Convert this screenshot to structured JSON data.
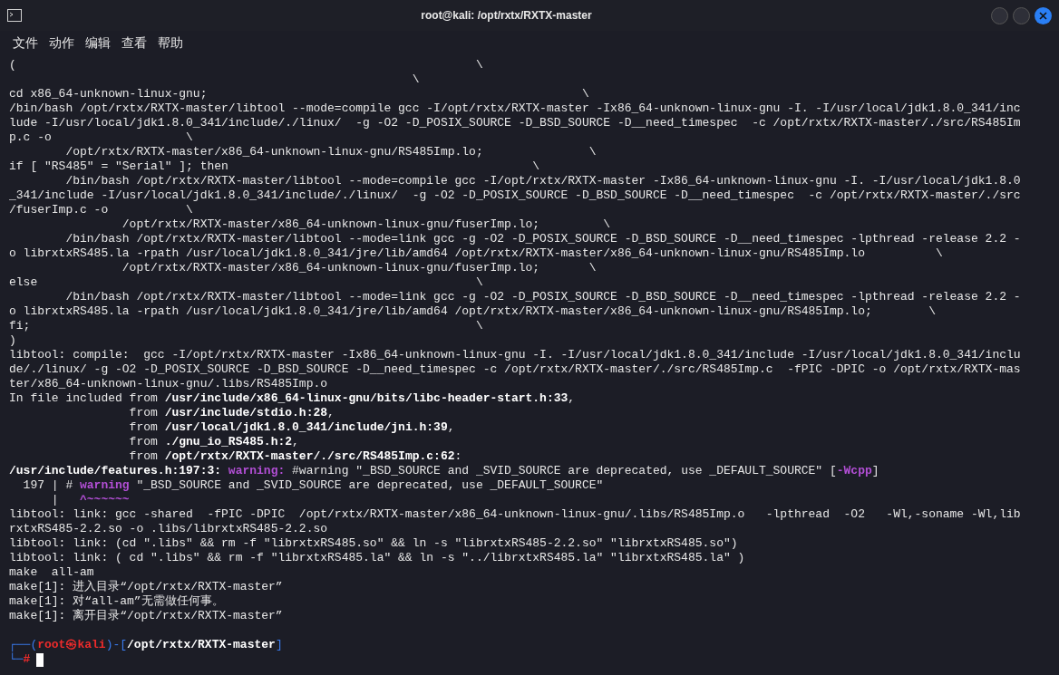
{
  "window": {
    "title": "root@kali: /opt/rxtx/RXTX-master"
  },
  "menu": [
    "文件",
    "动作",
    "编辑",
    "查看",
    "帮助"
  ],
  "lines": [
    {
      "segments": [
        {
          "kind": "plain",
          "text": "(                                                                 \\"
        }
      ]
    },
    {
      "segments": [
        {
          "kind": "plain",
          "text": "                                                         \\"
        }
      ]
    },
    {
      "segments": [
        {
          "kind": "plain",
          "text": "cd x86_64-unknown-linux-gnu;                                                     \\"
        }
      ]
    },
    {
      "segments": [
        {
          "kind": "plain",
          "text": "/bin/bash /opt/rxtx/RXTX-master/libtool --mode=compile gcc -I/opt/rxtx/RXTX-master -Ix86_64-unknown-linux-gnu -I. -I/usr/local/jdk1.8.0_341/inc"
        }
      ]
    },
    {
      "segments": [
        {
          "kind": "plain",
          "text": "lude -I/usr/local/jdk1.8.0_341/include/./linux/  -g -O2 -D_POSIX_SOURCE -D_BSD_SOURCE -D__need_timespec  -c /opt/rxtx/RXTX-master/./src/RS485Im"
        }
      ]
    },
    {
      "segments": [
        {
          "kind": "plain",
          "text": "p.c -o                   \\"
        }
      ]
    },
    {
      "segments": [
        {
          "kind": "plain",
          "text": "        /opt/rxtx/RXTX-master/x86_64-unknown-linux-gnu/RS485Imp.lo;               \\"
        }
      ]
    },
    {
      "segments": [
        {
          "kind": "plain",
          "text": "if [ \"RS485\" = \"Serial\" ]; then                                           \\"
        }
      ]
    },
    {
      "segments": [
        {
          "kind": "plain",
          "text": "        /bin/bash /opt/rxtx/RXTX-master/libtool --mode=compile gcc -I/opt/rxtx/RXTX-master -Ix86_64-unknown-linux-gnu -I. -I/usr/local/jdk1.8.0"
        }
      ]
    },
    {
      "segments": [
        {
          "kind": "plain",
          "text": "_341/include -I/usr/local/jdk1.8.0_341/include/./linux/  -g -O2 -D_POSIX_SOURCE -D_BSD_SOURCE -D__need_timespec  -c /opt/rxtx/RXTX-master/./src"
        }
      ]
    },
    {
      "segments": [
        {
          "kind": "plain",
          "text": "/fuserImp.c -o           \\"
        }
      ]
    },
    {
      "segments": [
        {
          "kind": "plain",
          "text": "                /opt/rxtx/RXTX-master/x86_64-unknown-linux-gnu/fuserImp.lo;         \\"
        }
      ]
    },
    {
      "segments": [
        {
          "kind": "plain",
          "text": "        /bin/bash /opt/rxtx/RXTX-master/libtool --mode=link gcc -g -O2 -D_POSIX_SOURCE -D_BSD_SOURCE -D__need_timespec -lpthread -release 2.2 -"
        }
      ]
    },
    {
      "segments": [
        {
          "kind": "plain",
          "text": "o librxtxRS485.la -rpath /usr/local/jdk1.8.0_341/jre/lib/amd64 /opt/rxtx/RXTX-master/x86_64-unknown-linux-gnu/RS485Imp.lo          \\"
        }
      ]
    },
    {
      "segments": [
        {
          "kind": "plain",
          "text": "                /opt/rxtx/RXTX-master/x86_64-unknown-linux-gnu/fuserImp.lo;       \\"
        }
      ]
    },
    {
      "segments": [
        {
          "kind": "plain",
          "text": "else                                                              \\"
        }
      ]
    },
    {
      "segments": [
        {
          "kind": "plain",
          "text": "        /bin/bash /opt/rxtx/RXTX-master/libtool --mode=link gcc -g -O2 -D_POSIX_SOURCE -D_BSD_SOURCE -D__need_timespec -lpthread -release 2.2 -"
        }
      ]
    },
    {
      "segments": [
        {
          "kind": "plain",
          "text": "o librxtxRS485.la -rpath /usr/local/jdk1.8.0_341/jre/lib/amd64 /opt/rxtx/RXTX-master/x86_64-unknown-linux-gnu/RS485Imp.lo;        \\"
        }
      ]
    },
    {
      "segments": [
        {
          "kind": "plain",
          "text": "fi;                                                               \\"
        }
      ]
    },
    {
      "segments": [
        {
          "kind": "plain",
          "text": ")"
        }
      ]
    },
    {
      "segments": [
        {
          "kind": "plain",
          "text": "libtool: compile:  gcc -I/opt/rxtx/RXTX-master -Ix86_64-unknown-linux-gnu -I. -I/usr/local/jdk1.8.0_341/include -I/usr/local/jdk1.8.0_341/inclu"
        }
      ]
    },
    {
      "segments": [
        {
          "kind": "plain",
          "text": "de/./linux/ -g -O2 -D_POSIX_SOURCE -D_BSD_SOURCE -D__need_timespec -c /opt/rxtx/RXTX-master/./src/RS485Imp.c  -fPIC -DPIC -o /opt/rxtx/RXTX-mas"
        }
      ]
    },
    {
      "segments": [
        {
          "kind": "plain",
          "text": "ter/x86_64-unknown-linux-gnu/.libs/RS485Imp.o"
        }
      ]
    },
    {
      "segments": [
        {
          "kind": "plain",
          "text": "In file included from "
        },
        {
          "kind": "bold",
          "text": "/usr/include/x86_64-linux-gnu/bits/libc-header-start.h:33"
        },
        {
          "kind": "plain",
          "text": ","
        }
      ]
    },
    {
      "segments": [
        {
          "kind": "plain",
          "text": "                 from "
        },
        {
          "kind": "bold",
          "text": "/usr/include/stdio.h:28"
        },
        {
          "kind": "plain",
          "text": ","
        }
      ]
    },
    {
      "segments": [
        {
          "kind": "plain",
          "text": "                 from "
        },
        {
          "kind": "bold",
          "text": "/usr/local/jdk1.8.0_341/include/jni.h:39"
        },
        {
          "kind": "plain",
          "text": ","
        }
      ]
    },
    {
      "segments": [
        {
          "kind": "plain",
          "text": "                 from "
        },
        {
          "kind": "bold",
          "text": "./gnu_io_RS485.h:2"
        },
        {
          "kind": "plain",
          "text": ","
        }
      ]
    },
    {
      "segments": [
        {
          "kind": "plain",
          "text": "                 from "
        },
        {
          "kind": "bold",
          "text": "/opt/rxtx/RXTX-master/./src/RS485Imp.c:62"
        },
        {
          "kind": "plain",
          "text": ":"
        }
      ]
    },
    {
      "segments": [
        {
          "kind": "bold",
          "text": "/usr/include/features.h:197:3: "
        },
        {
          "kind": "warning",
          "text": "warning:"
        },
        {
          "kind": "plain",
          "text": " #warning \"_BSD_SOURCE and _SVID_SOURCE are deprecated, use _DEFAULT_SOURCE\" ["
        },
        {
          "kind": "warning",
          "text": "-Wcpp"
        },
        {
          "kind": "plain",
          "text": "]"
        }
      ]
    },
    {
      "segments": [
        {
          "kind": "plain",
          "text": "  197 | # "
        },
        {
          "kind": "warning",
          "text": "warning"
        },
        {
          "kind": "plain",
          "text": " \"_BSD_SOURCE and _SVID_SOURCE are deprecated, use _DEFAULT_SOURCE\""
        }
      ]
    },
    {
      "segments": [
        {
          "kind": "plain",
          "text": "      |   "
        },
        {
          "kind": "warning",
          "text": "^~~~~~~"
        }
      ]
    },
    {
      "segments": [
        {
          "kind": "plain",
          "text": "libtool: link: gcc -shared  -fPIC -DPIC  /opt/rxtx/RXTX-master/x86_64-unknown-linux-gnu/.libs/RS485Imp.o   -lpthread  -O2   -Wl,-soname -Wl,lib"
        }
      ]
    },
    {
      "segments": [
        {
          "kind": "plain",
          "text": "rxtxRS485-2.2.so -o .libs/librxtxRS485-2.2.so"
        }
      ]
    },
    {
      "segments": [
        {
          "kind": "plain",
          "text": "libtool: link: (cd \".libs\" && rm -f \"librxtxRS485.so\" && ln -s \"librxtxRS485-2.2.so\" \"librxtxRS485.so\")"
        }
      ]
    },
    {
      "segments": [
        {
          "kind": "plain",
          "text": "libtool: link: ( cd \".libs\" && rm -f \"librxtxRS485.la\" && ln -s \"../librxtxRS485.la\" \"librxtxRS485.la\" )"
        }
      ]
    },
    {
      "segments": [
        {
          "kind": "plain",
          "text": "make  all-am"
        }
      ]
    },
    {
      "segments": [
        {
          "kind": "plain",
          "text": "make[1]: 进入目录“/opt/rxtx/RXTX-master”"
        }
      ]
    },
    {
      "segments": [
        {
          "kind": "plain",
          "text": "make[1]: 对“all-am”无需做任何事。"
        }
      ]
    },
    {
      "segments": [
        {
          "kind": "plain",
          "text": "make[1]: 离开目录“/opt/rxtx/RXTX-master”"
        }
      ]
    }
  ],
  "prompt": {
    "top": [
      {
        "kind": "frame",
        "text": "┌──("
      },
      {
        "kind": "user",
        "text": "root㉿kali"
      },
      {
        "kind": "frame",
        "text": ")-["
      },
      {
        "kind": "path",
        "text": "/opt/rxtx/RXTX-master"
      },
      {
        "kind": "frame",
        "text": "]"
      }
    ],
    "bottom": [
      {
        "kind": "frame",
        "text": "└─"
      },
      {
        "kind": "user",
        "text": "#"
      }
    ]
  }
}
